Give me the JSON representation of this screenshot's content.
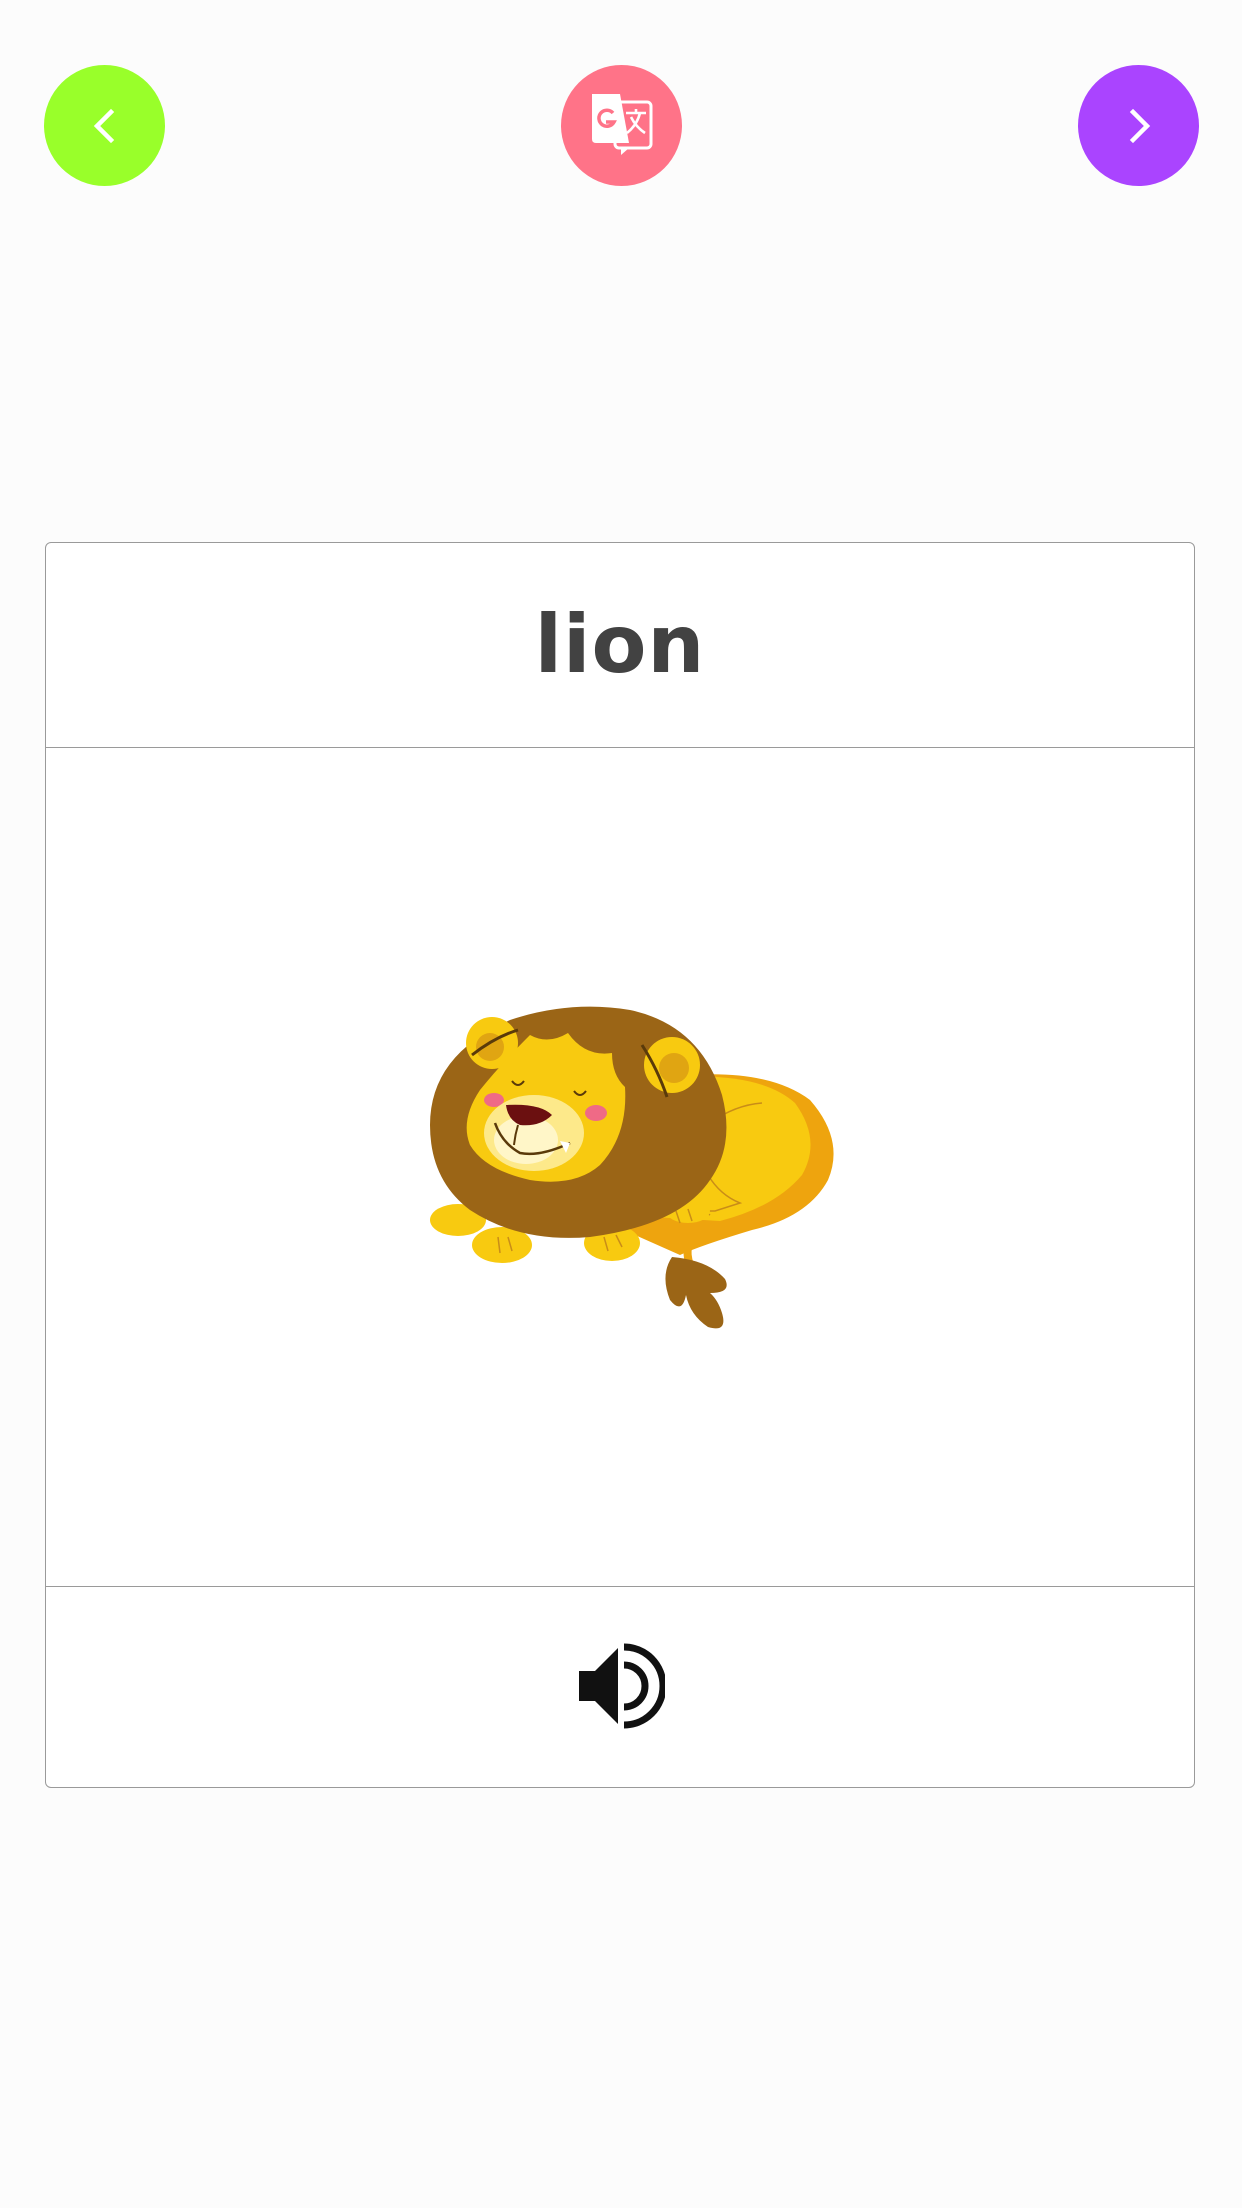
{
  "toolbar": {
    "prev_icon": "chevron-left-icon",
    "translate_icon": "google-translate-icon",
    "next_icon": "chevron-right-icon",
    "prev_color": "#99ff2a",
    "translate_color": "#ff7388",
    "next_color": "#aa44ff"
  },
  "card": {
    "word": "lion",
    "image_icon": "lion-illustration",
    "speaker_icon": "speaker-icon"
  },
  "colors": {
    "background": "#fcfcfc",
    "card_border": "#9a9a9a",
    "word_text": "#424242"
  }
}
